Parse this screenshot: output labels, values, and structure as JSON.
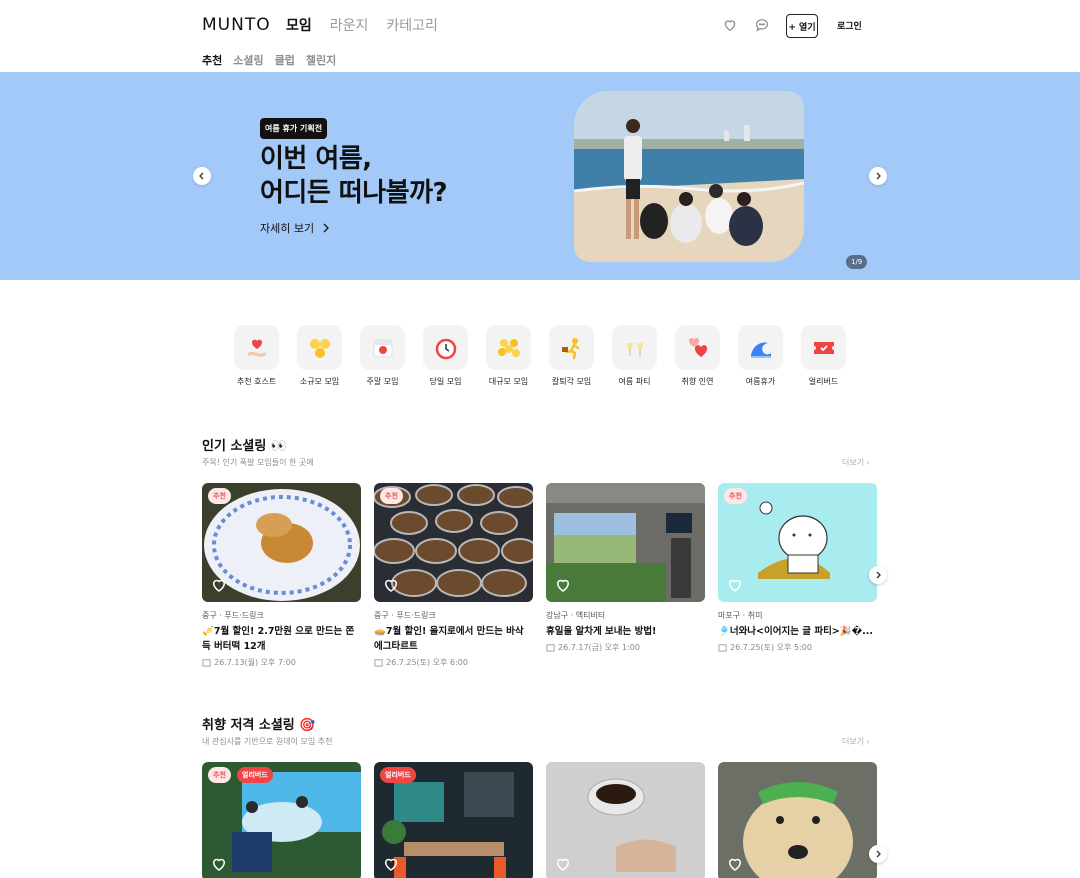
{
  "header": {
    "logo": "MUNTO",
    "nav": [
      "모임",
      "라운지",
      "카테고리"
    ],
    "open_label": "+ 열기",
    "login_label": "로그인"
  },
  "subnav": [
    "추천",
    "소셜링",
    "클럽",
    "챌린지"
  ],
  "banner": {
    "tag": "여름 휴가 기획전",
    "title_line1": "이번 여름,",
    "title_line2": "어디든 떠나볼까?",
    "more": "자세히 보기",
    "pager": "1/9",
    "bg_color": "#a3c9f8"
  },
  "categories": [
    {
      "label": "추천 호스트",
      "icon": "heart-hand-icon"
    },
    {
      "label": "소규모 모임",
      "icon": "small-group-icon"
    },
    {
      "label": "주말 모임",
      "icon": "calendar-icon"
    },
    {
      "label": "당일 모임",
      "icon": "alarm-clock-icon"
    },
    {
      "label": "대규모 모임",
      "icon": "big-group-icon"
    },
    {
      "label": "칼퇴각 모임",
      "icon": "runner-icon"
    },
    {
      "label": "여름 파티",
      "icon": "cheers-icon"
    },
    {
      "label": "취향 인연",
      "icon": "hearts-icon"
    },
    {
      "label": "여름휴가",
      "icon": "wave-icon"
    },
    {
      "label": "얼리버드",
      "icon": "ticket-icon"
    }
  ],
  "section1": {
    "title": "인기 소셜링 👀",
    "sub": "주목! 인기 폭발 모임들이 한 곳에",
    "more": "더보기 ›",
    "cards": [
      {
        "badge": "추천",
        "loc": "중구 · 푸드·드링크",
        "title": "🎺7월 할인! 2.7만원 으로 만드는 쫀득 버터떡 12개",
        "date": "26.7.13(월) 오후 7:00"
      },
      {
        "badge": "추천",
        "loc": "중구 · 푸드·드링크",
        "title": "🥧7월 할인! 을지로에서 만드는 바삭 에그타르트",
        "date": "26.7.25(토) 오후 6:00"
      },
      {
        "badge": "",
        "loc": "강남구 · 액티비티",
        "title": "휴일을 알차게 보내는 방법!",
        "date": "26.7.17(금) 오후 1:00"
      },
      {
        "badge": "추천",
        "loc": "마포구 · 취미",
        "title": "🎐너와나<이어지는 글 파티>🎉�...",
        "date": "26.7.25(토) 오후 5:00"
      }
    ]
  },
  "section2": {
    "title": "취향 저격 소셜링 🎯",
    "sub": "내 관심사를 기반으로 원데이 모임 추천",
    "more": "더보기 ›",
    "cards": [
      {
        "badge": "추천",
        "badge2": "얼리버드"
      },
      {
        "badge": "",
        "badge2": "얼리버드"
      },
      {
        "badge": "",
        "badge2": ""
      },
      {
        "badge": "",
        "badge2": ""
      }
    ]
  }
}
